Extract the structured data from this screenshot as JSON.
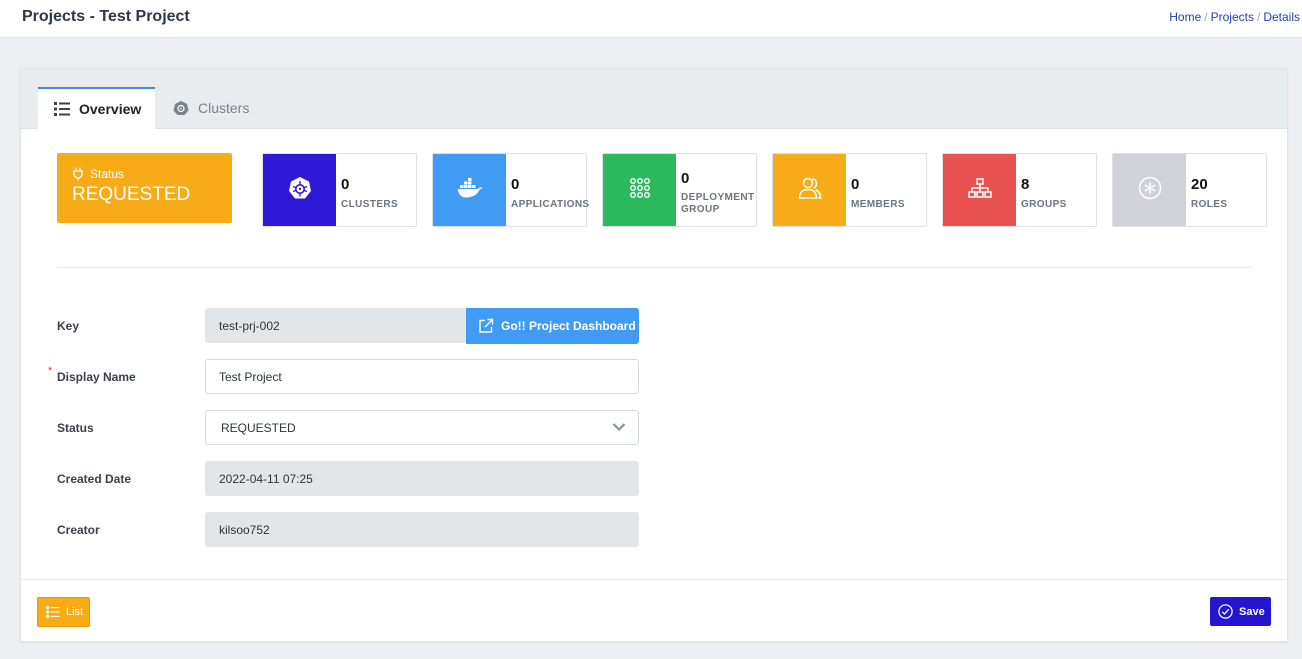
{
  "header": {
    "title": "Projects - Test Project",
    "breadcrumb": [
      "Home",
      "Projects",
      "Details"
    ]
  },
  "tabs": [
    {
      "label": "Overview",
      "icon": "list-icon",
      "active": true
    },
    {
      "label": "Clusters",
      "icon": "kubernetes-icon",
      "active": false
    }
  ],
  "status_card": {
    "label": "Status",
    "value": "REQUESTED",
    "color": "#f7ac17"
  },
  "stats": [
    {
      "value": "0",
      "label": "CLUSTERS",
      "color": "#3019d6",
      "icon": "kubernetes-icon"
    },
    {
      "value": "0",
      "label": "APPLICATIONS",
      "color": "#3f9bf4",
      "icon": "docker-icon"
    },
    {
      "value": "0",
      "label_line1": "DEPLOYMENT",
      "label_line2": "GROUP",
      "color": "#2cb85c",
      "icon": "grid-dots-icon"
    },
    {
      "value": "0",
      "label": "MEMBERS",
      "color": "#f7ac17",
      "icon": "users-icon"
    },
    {
      "value": "8",
      "label": "GROUPS",
      "color": "#e85251",
      "icon": "hierarchy-icon"
    },
    {
      "value": "20",
      "label": "ROLES",
      "color": "#cfd3d9",
      "icon": "asterisk-circle-icon"
    }
  ],
  "form": {
    "key": {
      "label": "Key",
      "value": "test-prj-002"
    },
    "go_button": "Go!! Project Dashboard",
    "display_name": {
      "label": "Display Name",
      "value": "Test Project",
      "required": "*"
    },
    "status": {
      "label": "Status",
      "value": "REQUESTED"
    },
    "created_date": {
      "label": "Created Date",
      "value": "2022-04-11 07:25"
    },
    "creator": {
      "label": "Creator",
      "value": "kilsoo752"
    }
  },
  "footer": {
    "list_label": "List",
    "save_label": "Save"
  }
}
